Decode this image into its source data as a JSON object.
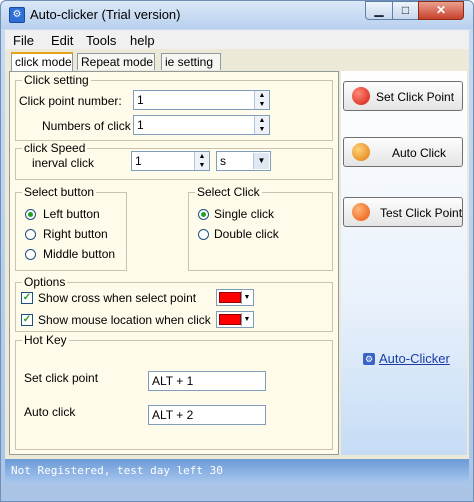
{
  "window": {
    "title": "Auto-clicker (Trial version)",
    "minimize": "▁",
    "maximize": "□",
    "close": "✕",
    "app_icon": "⚙"
  },
  "menu": {
    "file": "File",
    "edit": "Edit",
    "tools": "Tools",
    "help": "help"
  },
  "tabs": [
    "click mode",
    "Repeat mode",
    "ie setting"
  ],
  "click_setting": {
    "title": "Click setting",
    "point_label": "Click point number:",
    "point_value": "1",
    "count_label": "Numbers of click",
    "count_value": "1"
  },
  "click_speed": {
    "title": "click Speed",
    "interval_label": "inerval click",
    "interval_value": "1",
    "unit_value": "s"
  },
  "select_button": {
    "title": "Select button",
    "options": [
      "Left button",
      "Right button",
      "Middle button"
    ],
    "selected": 0
  },
  "select_click": {
    "title": "Select Click",
    "options": [
      "Single click",
      "Double click"
    ],
    "selected": 0
  },
  "options": {
    "title": "Options",
    "show_cross": "Show cross when select point",
    "show_mouse": "Show mouse location when click",
    "color": "#ff0000"
  },
  "hotkey": {
    "title": "Hot Key",
    "set_label": "Set click point",
    "set_value": "ALT + 1",
    "auto_label": "Auto click",
    "auto_value": "ALT + 2"
  },
  "side": {
    "set_point": "Set Click Point",
    "auto_click": "Auto Click",
    "test_point": "Test Click Point",
    "link": "Auto-Clicker"
  },
  "status": "Not Registered, test day left 30",
  "icons": {
    "spin_up": "▲",
    "spin_down": "▼",
    "dropdown": "▼",
    "check": "✓"
  }
}
